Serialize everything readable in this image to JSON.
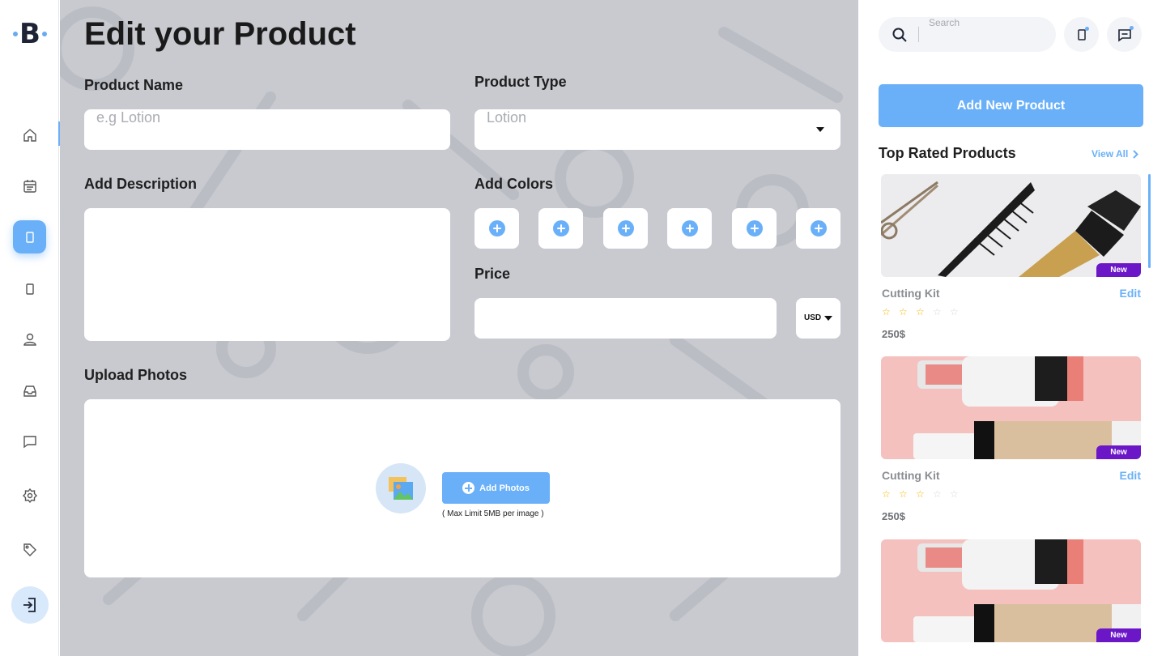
{
  "app": {
    "logo_text": "B"
  },
  "nav": {
    "items": [
      {
        "name": "home",
        "icon": "home-icon",
        "active": false
      },
      {
        "name": "calendar",
        "icon": "calendar-icon",
        "active": false
      },
      {
        "name": "products",
        "icon": "phone-icon",
        "active": true
      },
      {
        "name": "devices",
        "icon": "phone-icon",
        "active": false
      },
      {
        "name": "profile",
        "icon": "user-icon",
        "active": false
      },
      {
        "name": "inbox",
        "icon": "inbox-icon",
        "active": false
      },
      {
        "name": "messages",
        "icon": "chat-icon",
        "active": false
      },
      {
        "name": "settings",
        "icon": "gear-icon",
        "active": false
      },
      {
        "name": "tags",
        "icon": "tag-icon",
        "active": false
      }
    ],
    "logout_icon": "logout-icon"
  },
  "form": {
    "title": "Edit your Product",
    "product_name_label": "Product Name",
    "product_name_placeholder": "e.g Lotion",
    "product_type_label": "Product Type",
    "product_type_value": "Lotion",
    "description_label": "Add Description",
    "colors_label": "Add Colors",
    "price_label": "Price",
    "currency": "USD",
    "upload_label": "Upload Photos",
    "add_photos_label": "Add Photos",
    "upload_limit": "( Max Limit 5MB per image )"
  },
  "sidebar": {
    "search_placeholder": "Search",
    "add_button": "Add New Product",
    "top_rated_title": "Top Rated Products",
    "view_all": "View All",
    "products": [
      {
        "name": "Cutting Kit",
        "edit": "Edit",
        "price": "250$",
        "badge": "New",
        "rating": 3,
        "max_rating": 5
      },
      {
        "name": "Cutting Kit",
        "edit": "Edit",
        "price": "250$",
        "badge": "New",
        "rating": 3,
        "max_rating": 5
      },
      {
        "badge": "New"
      }
    ]
  },
  "colors": {
    "accent": "#6ab0f8",
    "badge": "#6b17c8",
    "star": "#f5b800",
    "background": "#c8cad0"
  }
}
